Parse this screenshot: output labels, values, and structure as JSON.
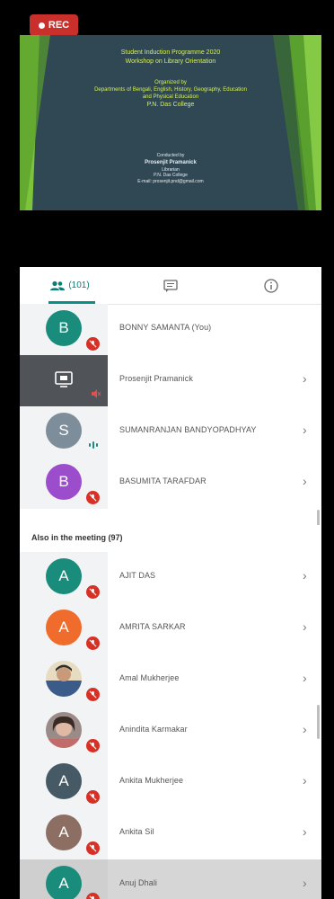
{
  "recording": {
    "label": "REC"
  },
  "slide": {
    "title_line1": "Student Induction Programme 2020",
    "title_line2": "Workshop on Library Orientation",
    "organized_by": "Organized by",
    "departments_line1": "Departments of Bengali, English, History, Geography, Education",
    "departments_line2": "and Physical Education",
    "college": "P.N. Das College",
    "conducted_by": "Conducted by",
    "presenter": "Prosenjit Pramanick",
    "role": "Librarian",
    "institution": "P.N. Das College",
    "email": "E-mail: prosenjit.pnd@gmail.com"
  },
  "tabs": {
    "people_count": "(101)",
    "people_icon": "people-icon",
    "chat_icon": "chat-icon",
    "info_icon": "info-icon"
  },
  "participants": [
    {
      "initial": "B",
      "name": "BONNY SAMANTA (You)",
      "color": "#1a8c7c",
      "status": "muted"
    },
    {
      "initial": "",
      "name": "Prosenjit Pramanick",
      "color": "#505458",
      "status": "presenting"
    },
    {
      "initial": "S",
      "name": "SUMANRANJAN BANDYOPADHYAY",
      "color": "#7d8e9a",
      "status": "speaking"
    },
    {
      "initial": "B",
      "name": "BASUMITA TARAFDAR",
      "color": "#9c4dcc",
      "status": "muted"
    }
  ],
  "section": {
    "label": "Also in the meeting (97)"
  },
  "others": [
    {
      "initial": "A",
      "name": "AJIT DAS",
      "color": "#1a8c7c"
    },
    {
      "initial": "A",
      "name": "AMRITA SARKAR",
      "color": "#ef6c2c"
    },
    {
      "initial": "",
      "name": "Amal Mukherjee",
      "color": "#3b5b8a"
    },
    {
      "initial": "",
      "name": "Anindita Karmakar",
      "color": "#8a6a6a"
    },
    {
      "initial": "A",
      "name": "Ankita Mukherjee",
      "color": "#455a64"
    },
    {
      "initial": "A",
      "name": "Ankita Sil",
      "color": "#8d6e63"
    },
    {
      "initial": "A",
      "name": "Anuj Dhali",
      "color": "#1a8c7c"
    }
  ],
  "colors": {
    "accent": "#0a8f85",
    "mic_off": "#d93025"
  }
}
